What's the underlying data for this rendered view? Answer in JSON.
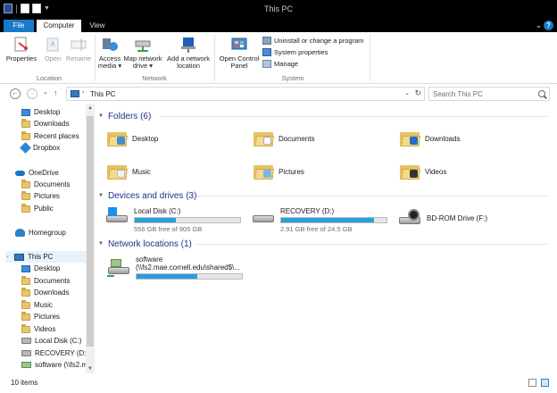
{
  "window": {
    "title": "This PC"
  },
  "ribbon_tabs": {
    "file": "File",
    "computer": "Computer",
    "view": "View"
  },
  "ribbon": {
    "location": {
      "label": "Location",
      "properties": "Properties",
      "open": "Open",
      "rename": "Rename"
    },
    "network": {
      "label": "Network",
      "access_media": "Access media ▾",
      "map_network_drive": "Map network drive ▾",
      "add_network_location": "Add a network location"
    },
    "system": {
      "label": "System",
      "open_control_panel": "Open Control Panel",
      "uninstall": "Uninstall or change a program",
      "system_properties": "System properties",
      "manage": "Manage"
    }
  },
  "address": {
    "path": "This PC"
  },
  "search": {
    "placeholder": "Search This PC"
  },
  "nav_pane": {
    "favorites": [
      "Desktop",
      "Downloads",
      "Recent places",
      "Dropbox"
    ],
    "onedrive": {
      "label": "OneDrive",
      "children": [
        "Documents",
        "Pictures",
        "Public"
      ]
    },
    "homegroup": "Homegroup",
    "this_pc": {
      "label": "This PC",
      "children": [
        "Desktop",
        "Documents",
        "Downloads",
        "Music",
        "Pictures",
        "Videos",
        "Local Disk (C:)",
        "RECOVERY (D:)",
        "software (\\\\fs2.m"
      ]
    }
  },
  "content": {
    "folders_header": "Folders (6)",
    "folders": [
      "Desktop",
      "Documents",
      "Downloads",
      "Music",
      "Pictures",
      "Videos"
    ],
    "devices_header": "Devices and drives (3)",
    "drives": [
      {
        "name": "Local Disk (C:)",
        "free": "556 GB free of 905 GB",
        "used_fraction": 0.39
      },
      {
        "name": "RECOVERY (D:)",
        "free": "2.91 GB free of 24.5 GB",
        "used_fraction": 0.88
      },
      {
        "name": "BD-ROM Drive (F:)"
      }
    ],
    "network_header": "Network locations (1)",
    "network": {
      "name_line1": "software",
      "name_line2": "(\\\\fs2.mae.cornell.edu\\shared$\\...",
      "used_fraction": 0.58
    }
  },
  "status": {
    "count": "10 items"
  },
  "colors": {
    "accent": "#1979ca",
    "header_text": "#1e3287",
    "bar_fill": "#26a0da"
  }
}
